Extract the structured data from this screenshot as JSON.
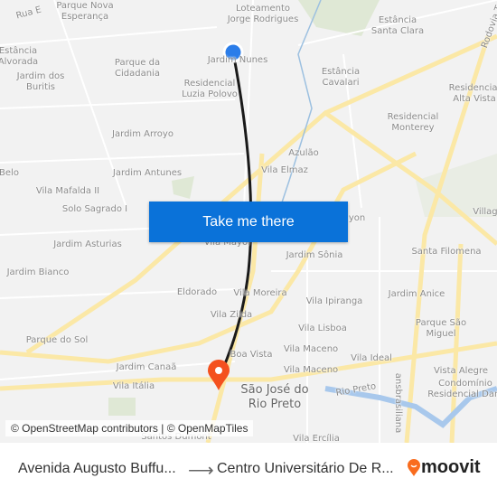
{
  "map": {
    "labels": [
      "Rua E",
      "Parque Nova\nEsperança",
      "Loteamento\nJorge Rodrigues",
      "Estância\nSanta Clara",
      "Rodovia T",
      "Estância\nAlvorada",
      "Jardim dos\nBuritis",
      "Parque da\nCidadania",
      "Jardim Nunes",
      "Residencial\nLuzia Polovo",
      "Estância\nCavalari",
      "Residencial\nAlta Vista",
      "Residencial\nMonterey",
      "Jardim Arroyo",
      "Azulão",
      "Jardim Antunes",
      "Vila Elmaz",
      "Belo",
      "Vila Mafalda II",
      "Solo Sagrado I",
      "Village",
      "Jardim Asturias",
      "Vila Mayor",
      "yon",
      "Santa Filomena",
      "Jardim Sônia",
      "Jardim Bianco",
      "Eldorado",
      "Vila Moreira",
      "Jardim Anice",
      "Vila Ipiranga",
      "Vila Zilda",
      "Parque São\nMiguel",
      "Parque do Sol",
      "Vila Lisboa",
      "Vila Maceno",
      "Boa Vista",
      "Vila Ideal",
      "Jardim Canaã",
      "Vila Maceno",
      "Vista Alegre",
      "Vila Itália",
      "Rio Preto",
      "Condomínio\nResidencial Dam",
      "Vila Ercília",
      "ansbrasiliana",
      "Santos Dumont"
    ],
    "city_label": "São José do\nRio Preto",
    "origin_color": "#2b7de9",
    "destination_color": "#f4511e",
    "route_color": "#1a1a1a"
  },
  "cta": {
    "label": "Take me there"
  },
  "attribution": "© OpenStreetMap contributors | © OpenMapTiles",
  "footer": {
    "from": "Avenida Augusto Buffu...",
    "arrow": "⟶",
    "to": "Centro Universitário De R...",
    "logo_text": "moovit",
    "logo_color": "#f96c1e"
  }
}
